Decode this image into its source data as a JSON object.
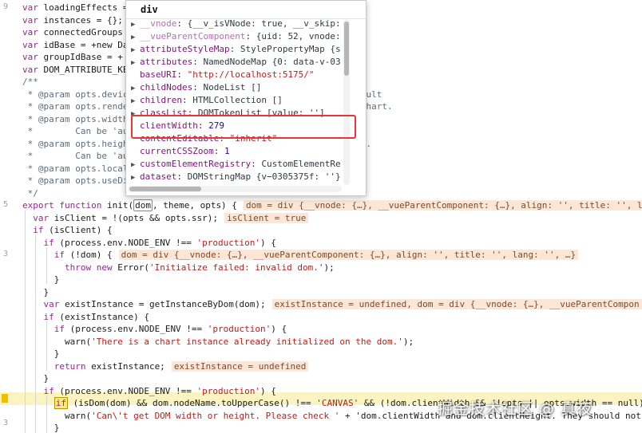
{
  "editor": {
    "gutter_numbers": [
      "9",
      "5",
      "3",
      "3"
    ],
    "lines": [
      {
        "tokens": [
          {
            "t": "var ",
            "c": "kw"
          },
          {
            "t": "loadingEffects",
            "c": "plain"
          },
          {
            "t": " =",
            "c": "plain"
          }
        ]
      },
      {
        "tokens": [
          {
            "t": "var ",
            "c": "kw"
          },
          {
            "t": "instances",
            "c": "plain"
          },
          {
            "t": " = {};",
            "c": "plain"
          }
        ]
      },
      {
        "tokens": [
          {
            "t": "var ",
            "c": "kw"
          },
          {
            "t": "connectedGroups",
            "c": "plain"
          }
        ]
      },
      {
        "tokens": [
          {
            "t": "var ",
            "c": "kw"
          },
          {
            "t": "idBase",
            "c": "plain"
          },
          {
            "t": " = +new Da",
            "c": "plain"
          }
        ]
      },
      {
        "tokens": [
          {
            "t": "var ",
            "c": "kw"
          },
          {
            "t": "groupIdBase",
            "c": "plain"
          },
          {
            "t": " = +",
            "c": "plain"
          }
        ]
      },
      {
        "tokens": [
          {
            "t": "var ",
            "c": "kw"
          },
          {
            "t": "DOM_ATTRIBUTE_KE",
            "c": "plain"
          }
        ]
      },
      {
        "tokens": [
          {
            "t": "/**",
            "c": "cm"
          }
        ]
      },
      {
        "tokens": [
          {
            "t": " * @param opts.devic",
            "c": "cm"
          },
          {
            "t": "                                          efault",
            "c": "cm"
          }
        ]
      },
      {
        "tokens": [
          {
            "t": " * @param opts.rende",
            "c": "cm"
          },
          {
            "t": "                                          e chart.",
            "c": "cm"
          }
        ]
      },
      {
        "tokens": [
          {
            "t": " * @param opts.width",
            "c": "cm"
          },
          {
            "t": "                                          t.",
            "c": "cm"
          }
        ]
      },
      {
        "tokens": [
          {
            "t": " *        Can be 'au",
            "c": "cm"
          }
        ]
      },
      {
        "tokens": [
          {
            "t": " * @param opts.heigh",
            "c": "cm"
          },
          {
            "t": "                                          ult.",
            "c": "cm"
          }
        ]
      },
      {
        "tokens": [
          {
            "t": " *        Can be 'au",
            "c": "cm"
          }
        ]
      },
      {
        "tokens": [
          {
            "t": " * @param opts.local",
            "c": "cm"
          }
        ]
      },
      {
        "tokens": [
          {
            "t": " * @param opts.useDi",
            "c": "cm"
          },
          {
            "t": "                                          ot.",
            "c": "cm"
          }
        ]
      },
      {
        "tokens": [
          {
            "t": " */",
            "c": "cm"
          }
        ]
      },
      {
        "tokens": [
          {
            "t": "export ",
            "c": "kw"
          },
          {
            "t": "function ",
            "c": "kw"
          },
          {
            "t": "init(",
            "c": "plain"
          },
          {
            "t": "dom",
            "c": "box"
          },
          {
            "t": ", theme, opts) {",
            "c": "plain"
          },
          {
            "t": "dom = div {__vnode: {…}, __vueParentComponent: {…}, align: '', title: '', l",
            "c": "val"
          }
        ]
      },
      {
        "tokens": [
          {
            "t": "  var ",
            "c": "kw"
          },
          {
            "t": "isClient = !(opts && opts.ssr);",
            "c": "plain"
          },
          {
            "t": "isClient = true",
            "c": "val"
          }
        ]
      },
      {
        "tokens": [
          {
            "t": "  if ",
            "c": "kw"
          },
          {
            "t": "(isClient) {",
            "c": "plain"
          }
        ]
      },
      {
        "tokens": [
          {
            "t": "    if ",
            "c": "kw"
          },
          {
            "t": "(process.env.NODE_ENV !== ",
            "c": "plain"
          },
          {
            "t": "'production'",
            "c": "str"
          },
          {
            "t": ") {",
            "c": "plain"
          }
        ]
      },
      {
        "tokens": [
          {
            "t": "      if ",
            "c": "kw"
          },
          {
            "t": "(!dom) {",
            "c": "plain"
          },
          {
            "t": "dom = div {__vnode: {…}, __vueParentComponent: {…}, align: '', title: '', lang: '', …}",
            "c": "val"
          }
        ]
      },
      {
        "tokens": [
          {
            "t": "        throw new ",
            "c": "kw"
          },
          {
            "t": "Error(",
            "c": "plain"
          },
          {
            "t": "'Initialize failed: invalid dom.'",
            "c": "str"
          },
          {
            "t": ");",
            "c": "plain"
          }
        ]
      },
      {
        "tokens": [
          {
            "t": "      }",
            "c": "plain"
          }
        ]
      },
      {
        "tokens": [
          {
            "t": "    }",
            "c": "plain"
          }
        ]
      },
      {
        "tokens": [
          {
            "t": "    var ",
            "c": "kw"
          },
          {
            "t": "existInstance = getInstanceByDom(dom);",
            "c": "plain"
          },
          {
            "t": "existInstance = undefined, dom = div {__vnode: {…}, __vueParentCompon",
            "c": "val"
          }
        ]
      },
      {
        "tokens": [
          {
            "t": "    if ",
            "c": "kw"
          },
          {
            "t": "(existInstance) {",
            "c": "plain"
          }
        ]
      },
      {
        "tokens": [
          {
            "t": "      if ",
            "c": "kw"
          },
          {
            "t": "(process.env.NODE_ENV !== ",
            "c": "plain"
          },
          {
            "t": "'production'",
            "c": "str"
          },
          {
            "t": ") {",
            "c": "plain"
          }
        ]
      },
      {
        "tokens": [
          {
            "t": "        warn(",
            "c": "plain"
          },
          {
            "t": "'There is a chart instance already initialized on the dom.'",
            "c": "str"
          },
          {
            "t": ");",
            "c": "plain"
          }
        ]
      },
      {
        "tokens": [
          {
            "t": "      }",
            "c": "plain"
          }
        ]
      },
      {
        "tokens": [
          {
            "t": "      return ",
            "c": "kw"
          },
          {
            "t": "existInstance;",
            "c": "plain"
          },
          {
            "t": "existInstance = undefined",
            "c": "val"
          }
        ]
      },
      {
        "tokens": [
          {
            "t": "    }",
            "c": "plain"
          }
        ]
      },
      {
        "tokens": [
          {
            "t": "    if ",
            "c": "kw"
          },
          {
            "t": "(process.env.NODE_ENV !== ",
            "c": "plain"
          },
          {
            "t": "'production'",
            "c": "str"
          },
          {
            "t": ") {",
            "c": "plain"
          }
        ]
      },
      {
        "tokens": [
          {
            "t": "      ",
            "c": "plain"
          },
          {
            "t": "if",
            "c": "pause"
          },
          {
            "t": " (isDom(dom) && dom.nodeName.toUpperCase() !== ",
            "c": "plain"
          },
          {
            "t": "'CANVAS'",
            "c": "str"
          },
          {
            "t": " && (!dom.clientWidth && (!opts || opts.width == null)",
            "c": "plain"
          }
        ]
      },
      {
        "tokens": [
          {
            "t": "        warn(",
            "c": "plain"
          },
          {
            "t": "'Can\\'t get DOM width or height. Please check '",
            "c": "str"
          },
          {
            "t": " + 'dom.clientWidth and dom.clientHeight. They should not",
            "c": "plain"
          }
        ]
      },
      {
        "tokens": [
          {
            "t": "      }",
            "c": "plain"
          }
        ]
      }
    ]
  },
  "popup": {
    "title": "div",
    "properties": [
      {
        "expand": true,
        "key": "__vnode",
        "proto": true,
        "sep": ": ",
        "value": "{__v_isVNode: true, __v_skip: ",
        "vclass": "pval"
      },
      {
        "expand": true,
        "key": "__vueParentComponent",
        "proto": true,
        "sep": ": ",
        "value": "{uid: 52, vnode: ",
        "vclass": "pval"
      },
      {
        "expand": true,
        "key": "attributeStyleMap",
        "proto": false,
        "sep": ": ",
        "value": "StylePropertyMap {s",
        "vclass": "pval"
      },
      {
        "expand": true,
        "key": "attributes",
        "proto": false,
        "sep": ": ",
        "value": "NamedNodeMap {0: data-v-03",
        "vclass": "pval"
      },
      {
        "expand": false,
        "key": "baseURI",
        "proto": false,
        "sep": ": ",
        "value": "\"http://localhost:5175/\"",
        "vclass": "pstr"
      },
      {
        "expand": true,
        "key": "childNodes",
        "proto": false,
        "sep": ": ",
        "value": "NodeList []",
        "vclass": "pval"
      },
      {
        "expand": true,
        "key": "children",
        "proto": false,
        "sep": ": ",
        "value": "HTMLCollection []",
        "vclass": "pval"
      },
      {
        "expand": true,
        "key": "classList",
        "proto": false,
        "sep": ": ",
        "value": "DOMTokenList [value: '']",
        "vclass": "pval"
      },
      {
        "expand": false,
        "key": "clientWidth",
        "proto": false,
        "sep": ": ",
        "value": "279",
        "vclass": "pnum"
      },
      {
        "expand": false,
        "key": "contentEditable",
        "proto": false,
        "sep": ": ",
        "value": "\"inherit\"",
        "vclass": "pstr"
      },
      {
        "expand": false,
        "key": "currentCSSZoom",
        "proto": false,
        "sep": ": ",
        "value": "1",
        "vclass": "pnum"
      },
      {
        "expand": true,
        "key": "customElementRegistry",
        "proto": false,
        "sep": ": ",
        "value": "CustomElementRe",
        "vclass": "pval"
      },
      {
        "expand": true,
        "key": "dataset",
        "proto": false,
        "sep": ": ",
        "value": "DOMStringMap {v−0305375f: ''}",
        "vclass": "pval"
      }
    ]
  },
  "watermark": "掘金技术社区 @ 真夜",
  "colors": {
    "annotation": "#e53535",
    "paused_line": "#fbf4c2",
    "inline_value_bg": "#fde6d6"
  }
}
